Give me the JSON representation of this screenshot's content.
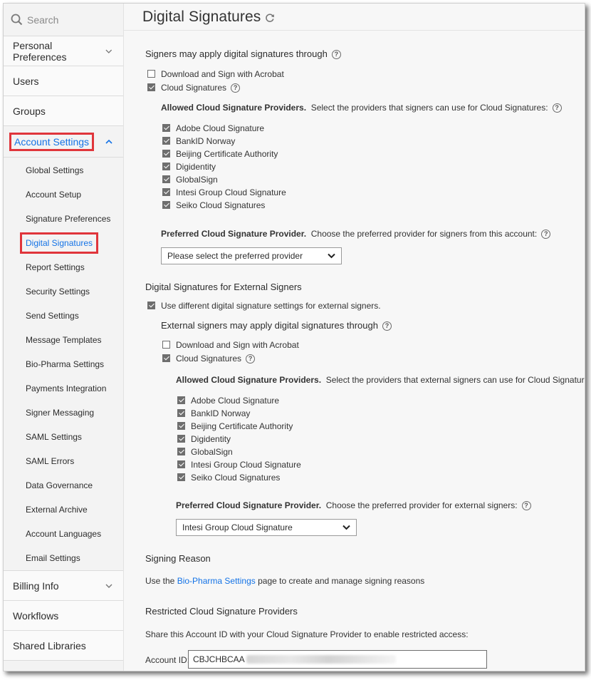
{
  "search": {
    "placeholder": "Search"
  },
  "sidebar": {
    "top_items": [
      {
        "label": "Personal Preferences",
        "has_chevron": true
      },
      {
        "label": "Users"
      },
      {
        "label": "Groups"
      }
    ],
    "active_section": {
      "label": "Account Settings"
    },
    "sub_items": [
      "Global Settings",
      "Account Setup",
      "Signature Preferences",
      "Digital Signatures",
      "Report Settings",
      "Security Settings",
      "Send Settings",
      "Message Templates",
      "Bio-Pharma Settings",
      "Payments Integration",
      "Signer Messaging",
      "SAML Settings",
      "SAML Errors",
      "Data Governance",
      "External Archive",
      "Account Languages",
      "Email Settings"
    ],
    "active_sub_item": "Digital Signatures",
    "bottom_items": [
      {
        "label": "Billing Info",
        "has_chevron": true
      },
      {
        "label": "Workflows"
      },
      {
        "label": "Shared Libraries"
      }
    ]
  },
  "page": {
    "title": "Digital Signatures"
  },
  "signers": {
    "heading": "Signers may apply digital signatures through",
    "download_sign": {
      "label": "Download and Sign with Acrobat",
      "checked": false
    },
    "cloud_signatures": {
      "label": "Cloud Signatures",
      "checked": true
    },
    "allowed_title": "Allowed Cloud Signature Providers.",
    "allowed_desc": "Select the providers that signers can use for Cloud Signatures:",
    "providers": [
      "Adobe Cloud Signature",
      "BankID Norway",
      "Beijing Certificate Authority",
      "Digidentity",
      "GlobalSign",
      "Intesi Group Cloud Signature",
      "Seiko Cloud Signatures"
    ],
    "preferred_title": "Preferred Cloud Signature Provider.",
    "preferred_desc": "Choose the preferred provider for signers from this account:",
    "preferred_value": "Please select the preferred provider"
  },
  "external": {
    "heading": "Digital Signatures for External Signers",
    "use_different": {
      "label": "Use different digital signature settings for external signers.",
      "checked": true
    },
    "subheading": "External signers may apply digital signatures through",
    "download_sign": {
      "label": "Download and Sign with Acrobat",
      "checked": false
    },
    "cloud_signatures": {
      "label": "Cloud Signatures",
      "checked": true
    },
    "allowed_title": "Allowed Cloud Signature Providers.",
    "allowed_desc": "Select the providers that external signers can use for Cloud Signatures:",
    "providers": [
      "Adobe Cloud Signature",
      "BankID Norway",
      "Beijing Certificate Authority",
      "Digidentity",
      "GlobalSign",
      "Intesi Group Cloud Signature",
      "Seiko Cloud Signatures"
    ],
    "preferred_title": "Preferred Cloud Signature Provider.",
    "preferred_desc": "Choose the preferred provider for external signers:",
    "preferred_value": "Intesi Group Cloud Signature"
  },
  "signing_reason": {
    "heading": "Signing Reason",
    "text_before": "Use the",
    "link": "Bio-Pharma Settings",
    "text_after": "page to create and manage signing reasons"
  },
  "restricted": {
    "heading": "Restricted Cloud Signature Providers",
    "desc": "Share this Account ID with your Cloud Signature Provider to enable restricted access:",
    "account_label": "Account ID:",
    "account_value": "CBJCHBCAA"
  },
  "colors": {
    "accent": "#1473e6",
    "highlight": "#e0353b",
    "checkbox": "#6e6e6e"
  }
}
